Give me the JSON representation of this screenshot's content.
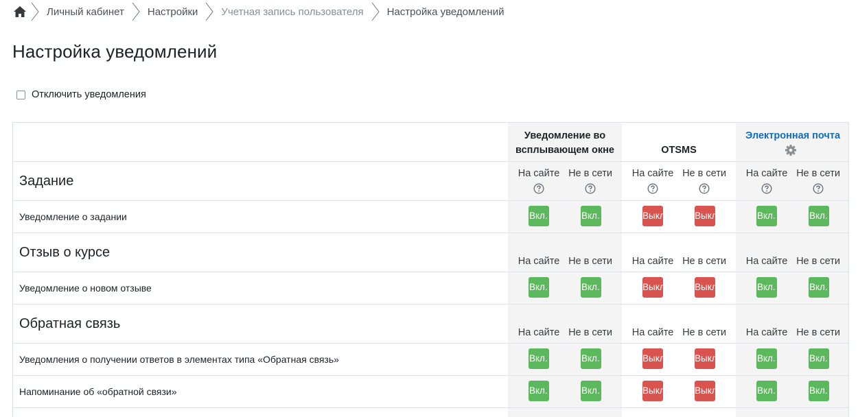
{
  "breadcrumb": {
    "items": [
      {
        "label": "Личный кабинет"
      },
      {
        "label": "Настройки"
      },
      {
        "label": "Учетная запись пользователя"
      },
      {
        "label": "Настройка уведомлений"
      }
    ]
  },
  "page": {
    "title": "Настройка уведомлений",
    "disable_label": "Отключить уведомления",
    "disable_checked": false
  },
  "processors": [
    {
      "name": "Уведомление во всплывающем окне"
    },
    {
      "name": "OTSMS"
    },
    {
      "name": "Электронная почта",
      "has_settings": true,
      "settings_icon": "gear-icon"
    }
  ],
  "states": {
    "online": "На сайте",
    "offline": "Не в сети"
  },
  "toggle_labels": {
    "on": "Вкл.",
    "off": "Выкл."
  },
  "colors": {
    "on": "#5cb85c",
    "off": "#d9534f",
    "link": "#0f6cbf"
  },
  "sections": [
    {
      "title": "Задание",
      "has_help": true,
      "items": [
        {
          "label": "Уведомление о задании",
          "values": [
            "on",
            "on",
            "off",
            "off",
            "on",
            "on"
          ]
        }
      ]
    },
    {
      "title": "Отзыв о курсе",
      "has_help": false,
      "items": [
        {
          "label": "Уведомление о новом отзыве",
          "values": [
            "on",
            "on",
            "off",
            "off",
            "on",
            "on"
          ]
        }
      ]
    },
    {
      "title": "Обратная связь",
      "has_help": false,
      "items": [
        {
          "label": "Уведомления о получении ответов в элементах типа «Обратная связь»",
          "values": [
            "on",
            "on",
            "off",
            "off",
            "on",
            "on"
          ]
        },
        {
          "label": "Напоминание об «обратной связи»",
          "values": [
            "on",
            "on",
            "off",
            "off",
            "on",
            "on"
          ]
        }
      ]
    }
  ]
}
